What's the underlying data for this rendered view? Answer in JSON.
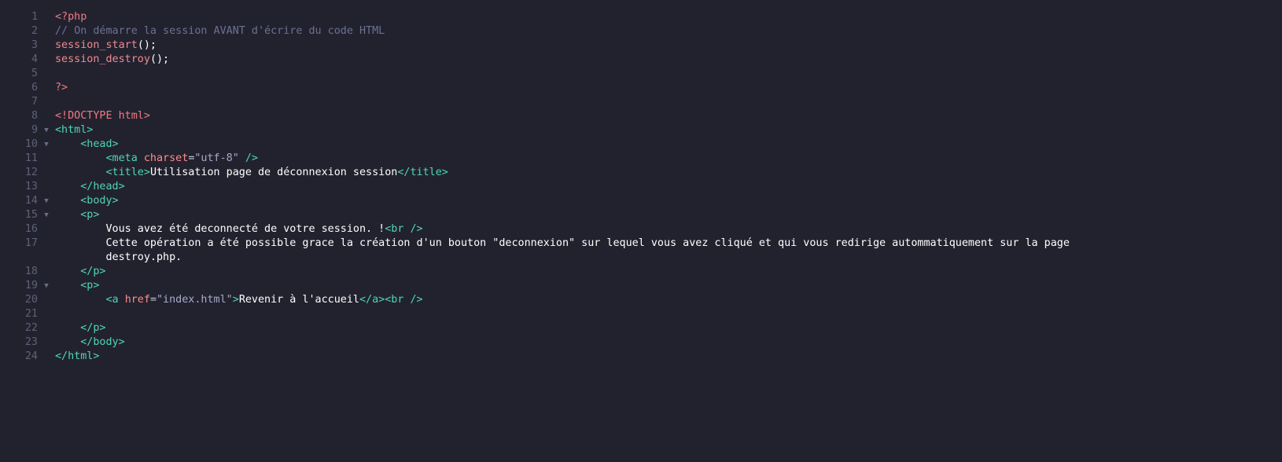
{
  "colors": {
    "background": "#22222f",
    "line_number": "#5d6178",
    "php_keyword": "#f07a82",
    "comment": "#6c7191",
    "function": "#f08a8e",
    "tag": "#4fd6b0",
    "attribute": "#ff8b8b",
    "string": "#a7a9ce",
    "text": "#ffffff"
  },
  "lines": [
    {
      "n": "1"
    },
    {
      "n": "2",
      "comment": "// On démarre la session AVANT d'écrire du code HTML"
    },
    {
      "n": "3",
      "fn": "session_start",
      "punc": "();"
    },
    {
      "n": "4",
      "fn": "session_destroy",
      "punc": "();"
    },
    {
      "n": "5"
    },
    {
      "n": "6",
      "php_close": "?>"
    },
    {
      "n": "7"
    },
    {
      "n": "8",
      "doctype": "<!DOCTYPE html>"
    },
    {
      "n": "9",
      "tag": "<html>"
    },
    {
      "n": "10",
      "tag": "<head>"
    },
    {
      "n": "11",
      "tag_open": "<meta",
      "attr": "charset",
      "eq": "=",
      "str": "\"utf-8\"",
      "tag_close": " />"
    },
    {
      "n": "12",
      "tag_open": "<title>",
      "text": "Utilisation page de déconnexion session",
      "tag_close": "</title>"
    },
    {
      "n": "13",
      "tag": "</head>"
    },
    {
      "n": "14",
      "tag": "<body>"
    },
    {
      "n": "15",
      "tag": "<p>"
    },
    {
      "n": "16",
      "text": "Vous avez été deconnecté de votre session. !",
      "tag": "<br />"
    },
    {
      "n": "17",
      "text_a": "Cette opération a été possible grace la création d'un bouton \"deconnexion\" sur lequel vous avez cliqué et qui vous redirige autommatiquement sur la page",
      "text_b": "destroy.php."
    },
    {
      "n": "18",
      "tag": "</p>"
    },
    {
      "n": "19",
      "tag": "<p>"
    },
    {
      "n": "20",
      "tag_open": "<a",
      "attr": "href",
      "eq": "=",
      "str": "\"index.html\"",
      "tag_mid": ">",
      "text": "Revenir à l'accueil",
      "tag_close": "</a><br />"
    },
    {
      "n": "21"
    },
    {
      "n": "22",
      "tag": "</p>"
    },
    {
      "n": "23",
      "tag": "</body>"
    },
    {
      "n": "24",
      "tag": "</html>"
    }
  ],
  "php_open": "<?php",
  "fold_marker": "▼"
}
